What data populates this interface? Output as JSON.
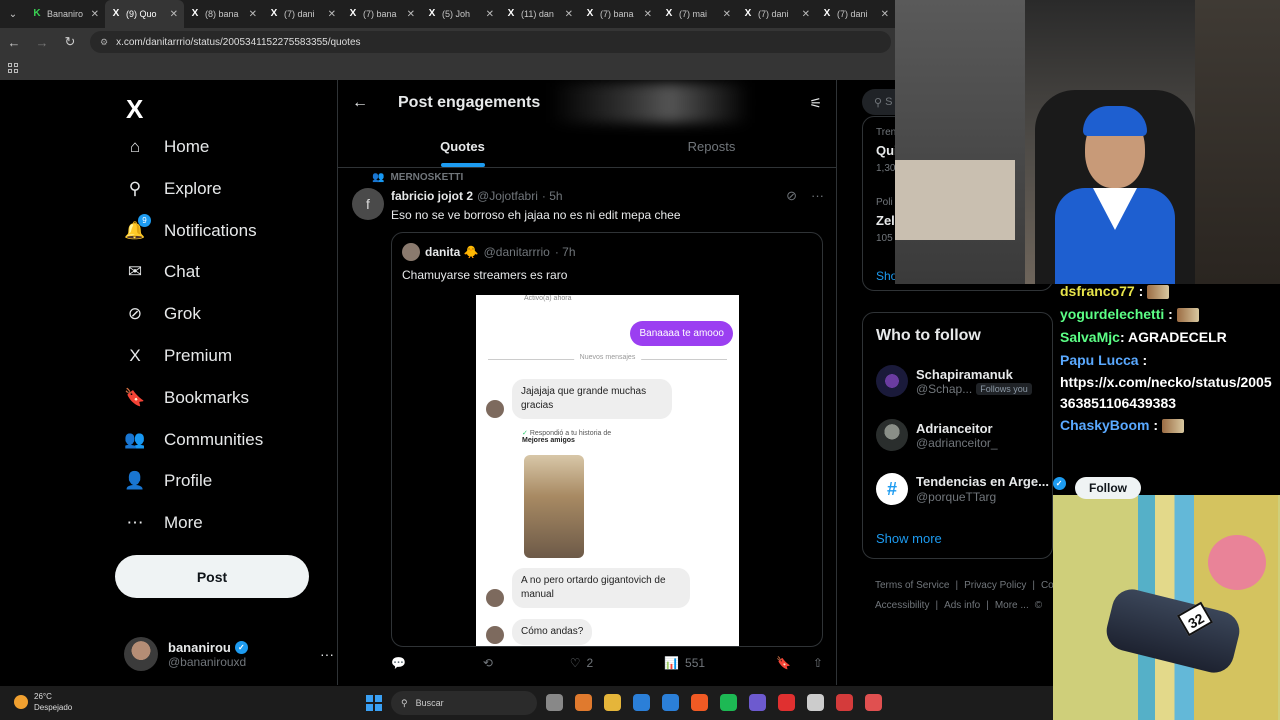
{
  "browser": {
    "tabs": [
      {
        "icon": "K",
        "icon_color": "green",
        "title": "Bananiro"
      },
      {
        "icon": "X",
        "title": "(9) Quo",
        "active": true
      },
      {
        "icon": "X",
        "title": "(8) bana"
      },
      {
        "icon": "X",
        "title": "(7) dani"
      },
      {
        "icon": "X",
        "title": "(7) bana"
      },
      {
        "icon": "X",
        "title": "(5) Joh"
      },
      {
        "icon": "X",
        "title": "(11) dan"
      },
      {
        "icon": "X",
        "title": "(7) bana"
      },
      {
        "icon": "X",
        "title": "(7) mai"
      },
      {
        "icon": "X",
        "title": "(7) dani"
      },
      {
        "icon": "X",
        "title": "(7) dani"
      }
    ],
    "tab_close": "✕",
    "url": "x.com/danitarrrio/status/2005341152275583355/quotes"
  },
  "nav": {
    "logo": "X",
    "items": [
      {
        "label": "Home",
        "icon": "home-icon",
        "glyph": "⌂"
      },
      {
        "label": "Explore",
        "icon": "search-icon",
        "glyph": "⚲"
      },
      {
        "label": "Notifications",
        "icon": "bell-icon",
        "glyph": "🔔",
        "badge": "9"
      },
      {
        "label": "Chat",
        "icon": "mail-icon",
        "glyph": "✉"
      },
      {
        "label": "Grok",
        "icon": "grok-icon",
        "glyph": "⊘"
      },
      {
        "label": "Premium",
        "icon": "x-premium-icon",
        "glyph": "X"
      },
      {
        "label": "Bookmarks",
        "icon": "bookmark-icon",
        "glyph": "🔖"
      },
      {
        "label": "Communities",
        "icon": "communities-icon",
        "glyph": "👥"
      },
      {
        "label": "Profile",
        "icon": "profile-icon",
        "glyph": "👤"
      },
      {
        "label": "More",
        "icon": "more-icon",
        "glyph": "⋯"
      }
    ],
    "post_label": "Post",
    "account": {
      "name": "bananirou",
      "handle": "@bananirouxd",
      "more": "···"
    }
  },
  "main": {
    "title": "Post engagements",
    "tabs": [
      "Quotes",
      "Reposts"
    ],
    "tweet": {
      "social_context": "MERNOSKETTI",
      "avatar_letter": "f",
      "name": "fabricio jojot 2",
      "handle": "@Jojotfabri",
      "time": "· 5h",
      "text": "Eso no se ve borroso eh jajaa no es ni edit mepa chee",
      "quote": {
        "name": "danita 🐥",
        "handle": "@danitarrrio",
        "time": "· 7h",
        "text": "Chamuyarse streamers es raro",
        "screenshot": {
          "status": "Activo(a) ahora",
          "sent": "Banaaaa te amooo",
          "divider": "Nuevos mensajes",
          "msg1": "Jajajaja que grande muchas gracias",
          "reply_label": "Respondió a tu historia de",
          "reply_sub": "Mejores amigos",
          "msg2": "A no pero ortardo gigantovich de manual",
          "msg3": "Cómo andas?"
        }
      },
      "actions": {
        "replies": "",
        "reposts": "",
        "likes": "2",
        "views": "551"
      }
    }
  },
  "right": {
    "search_placeholder": "S",
    "trends": [
      {
        "cat": "Tren",
        "title": "Qui",
        "count": "1,30"
      },
      {
        "cat": "Poli",
        "title": "Zel",
        "count": "105"
      }
    ],
    "trends_show": "Sho",
    "who_to_follow": "Who to follow",
    "suggestions": [
      {
        "name": "Schapiramanuk",
        "handle": "@Schap...",
        "follows_you": "Follows you"
      },
      {
        "name": "Adrianceitor",
        "handle": "@adrianceitor_"
      },
      {
        "name": "Tendencias en Arge...",
        "handle": "@porqueTTarg",
        "verified": true
      }
    ],
    "follow_label": "Follow",
    "show_more": "Show more",
    "footer": [
      "Terms of Service",
      "|",
      "Privacy Policy",
      "|",
      "Co",
      "Accessibility",
      "|",
      "Ads info",
      "|",
      "More ...",
      "©"
    ]
  },
  "chat": [
    {
      "user": "dsfranco77",
      "msg": "",
      "emote": true
    },
    {
      "user": "yogurdelechetti",
      "msg": "",
      "emote": true
    },
    {
      "user": "SalvaMjc",
      "msg": "AGRADECELR"
    },
    {
      "user": "Papu Lucca",
      "msg": "https://x.com/necko/status/2005363851106439383"
    },
    {
      "user": "ChaskyBoom",
      "msg": "",
      "emote": true
    }
  ],
  "game": {
    "car_number": "32"
  },
  "taskbar": {
    "temp": "26°C",
    "weather": "Despejado",
    "search": "Buscar",
    "icon_colors": [
      "#888",
      "#e07a2e",
      "#e5b53a",
      "#2b7fd8",
      "#2b7fd8",
      "#f05a24",
      "#1db954",
      "#6d5acf",
      "#e03030",
      "#ccc",
      "#d43b3b",
      "#e05050"
    ]
  }
}
